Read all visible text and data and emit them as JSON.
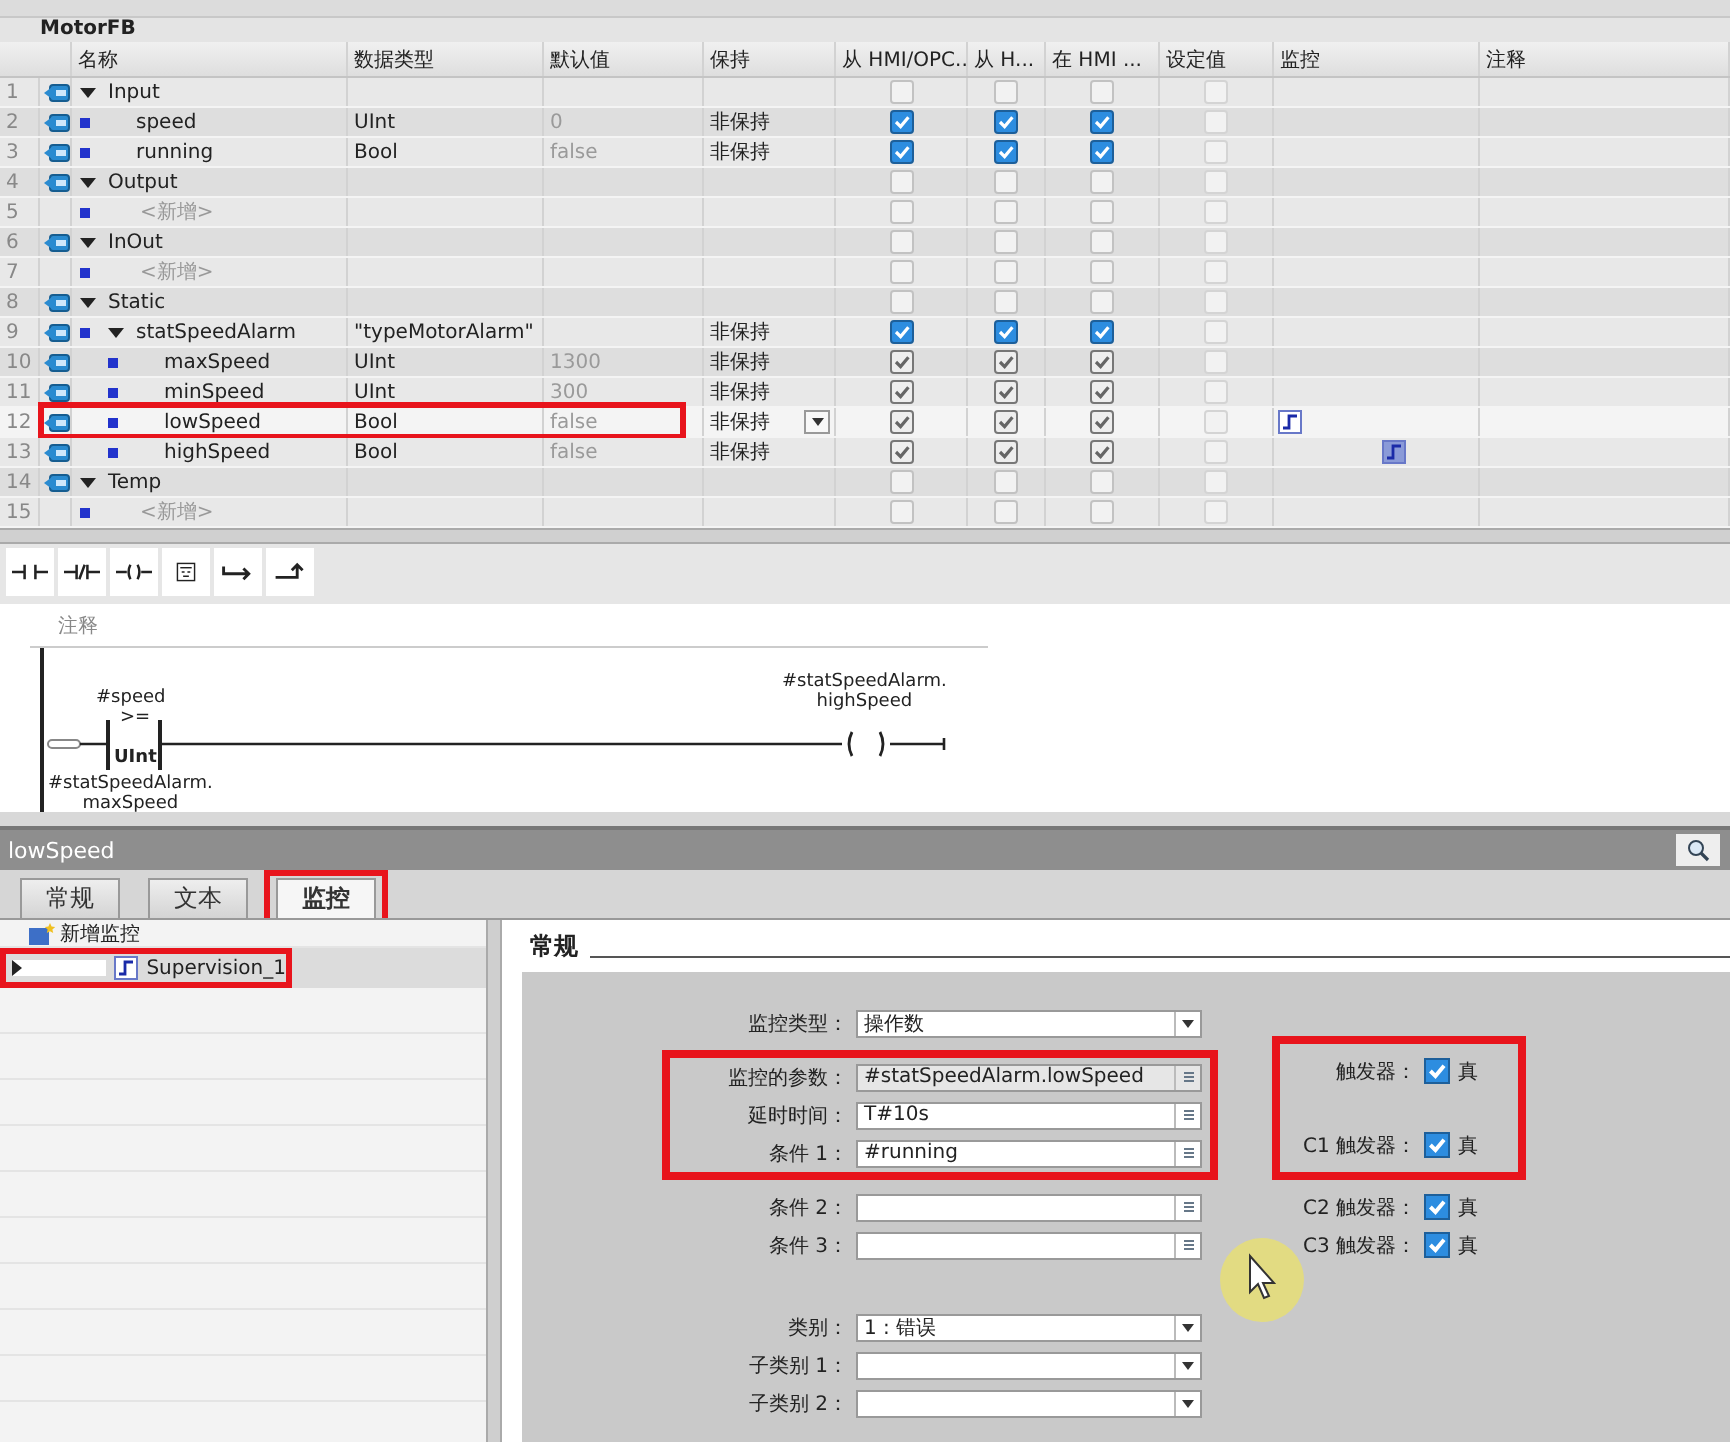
{
  "table": {
    "title": "MotorFB",
    "columns": [
      "名称",
      "数据类型",
      "默认值",
      "保持",
      "从 HMI/OPC..",
      "从 H...",
      "在 HMI ...",
      "设定值",
      "监控",
      "注释"
    ],
    "rows": [
      {
        "num": "1",
        "kind": "section",
        "name": "Input",
        "expanded": true,
        "hmi": [
          false,
          false,
          false
        ],
        "setpoint": false,
        "children": [
          {
            "num": "2",
            "kind": "member",
            "name": "speed",
            "type": "UInt",
            "default": "0",
            "retain": "非保持",
            "hmi": [
              true,
              true,
              true
            ],
            "setpoint": false
          },
          {
            "num": "3",
            "kind": "member",
            "name": "running",
            "type": "Bool",
            "default": "false",
            "retain": "非保持",
            "hmi": [
              true,
              true,
              true
            ],
            "setpoint": false
          }
        ]
      },
      {
        "num": "4",
        "kind": "section",
        "name": "Output",
        "expanded": true,
        "hmi": [
          false,
          false,
          false
        ],
        "setpoint": false,
        "children": [
          {
            "num": "5",
            "kind": "new",
            "name": "<新增>",
            "hmi": [
              false,
              false,
              false
            ],
            "setpoint": false
          }
        ]
      },
      {
        "num": "6",
        "kind": "section",
        "name": "InOut",
        "expanded": true,
        "hmi": [
          false,
          false,
          false
        ],
        "setpoint": false,
        "children": [
          {
            "num": "7",
            "kind": "new",
            "name": "<新增>",
            "hmi": [
              false,
              false,
              false
            ],
            "setpoint": false
          }
        ]
      },
      {
        "num": "8",
        "kind": "section",
        "name": "Static",
        "expanded": true,
        "hmi": [
          false,
          false,
          false
        ],
        "setpoint": false,
        "children": [
          {
            "num": "9",
            "kind": "member",
            "name": "statSpeedAlarm",
            "type": "\"typeMotorAlarm\"",
            "retain": "非保持",
            "expanded": true,
            "hmi": [
              true,
              true,
              true
            ],
            "setpoint": false,
            "children": [
              {
                "num": "10",
                "kind": "member",
                "name": "maxSpeed",
                "type": "UInt",
                "default": "1300",
                "retain": "非保持",
                "hmi": [
                  true,
                  true,
                  true
                ],
                "inherited": true,
                "setpoint": false
              },
              {
                "num": "11",
                "kind": "member",
                "name": "minSpeed",
                "type": "UInt",
                "default": "300",
                "retain": "非保持",
                "hmi": [
                  true,
                  true,
                  true
                ],
                "inherited": true,
                "setpoint": false
              },
              {
                "num": "12",
                "kind": "member",
                "name": "lowSpeed",
                "type": "Bool",
                "default": "false",
                "retain": "非保持",
                "hmi": [
                  true,
                  true,
                  true
                ],
                "inherited": true,
                "setpoint": false,
                "dropdown": true,
                "highlighted": true,
                "supervision": {
                  "selected": false
                }
              },
              {
                "num": "13",
                "kind": "member",
                "name": "highSpeed",
                "type": "Bool",
                "default": "false",
                "retain": "非保持",
                "hmi": [
                  true,
                  true,
                  true
                ],
                "inherited": true,
                "setpoint": false,
                "supervision": {
                  "selected": true
                }
              }
            ]
          }
        ]
      },
      {
        "num": "14",
        "kind": "section",
        "name": "Temp",
        "expanded": true,
        "hmi": [
          false,
          false,
          false
        ],
        "setpoint": false,
        "children": [
          {
            "num": "15",
            "kind": "new",
            "name": "<新增>",
            "hmi": [
              false,
              false,
              false
            ],
            "setpoint": false
          }
        ]
      }
    ]
  },
  "ladder": {
    "comment": "注释",
    "contact_operand": "#speed",
    "compare_op": ">=",
    "compare_type": "UInt",
    "compare_operand": [
      "#statSpeedAlarm.",
      "maxSpeed"
    ],
    "coil_operand": [
      "#statSpeedAlarm.",
      "highSpeed"
    ]
  },
  "properties": {
    "title": "lowSpeed",
    "tabs": [
      {
        "label": "常规",
        "selected": false,
        "highlighted": false
      },
      {
        "label": "文本",
        "selected": false,
        "highlighted": false
      },
      {
        "label": "监控",
        "selected": true,
        "highlighted": true
      }
    ],
    "supervisions": {
      "add_label": "新增监控",
      "items": [
        {
          "name": "Supervision_1",
          "selected": true,
          "highlighted": true
        }
      ]
    },
    "section_title": "常规",
    "field_groups": [
      {
        "highlighted": false,
        "fields": [
          {
            "label": "监控类型：",
            "value": "操作数",
            "kind": "dropdown"
          }
        ]
      },
      {
        "highlighted": true,
        "fields": [
          {
            "label": "监控的参数：",
            "value": "#statSpeedAlarm.lowSpeed",
            "kind": "readonly"
          },
          {
            "label": "延时时间：",
            "value": "T#10s",
            "kind": "input"
          },
          {
            "label": "条件 1：",
            "value": "#running",
            "kind": "input"
          }
        ]
      },
      {
        "highlighted": false,
        "fields": [
          {
            "label": "条件 2：",
            "kind": "input"
          },
          {
            "label": "条件 3：",
            "kind": "input"
          }
        ]
      },
      {
        "highlighted": false,
        "fields": [
          {
            "label": "类别：",
            "value": "1 : 错误",
            "kind": "dropdown"
          },
          {
            "label": "子类别 1：",
            "kind": "dropdown"
          },
          {
            "label": "子类别 2：",
            "kind": "dropdown"
          }
        ]
      }
    ],
    "trigger_groups": [
      {
        "highlighted": true,
        "triggers": [
          {
            "label": "触发器：",
            "text": "真",
            "checked": true
          },
          {
            "label": "C1 触发器：",
            "text": "真",
            "checked": true
          }
        ]
      },
      {
        "highlighted": false,
        "triggers": [
          {
            "label": "C2 触发器：",
            "text": "真",
            "checked": true
          },
          {
            "label": "C3 触发器：",
            "text": "真",
            "checked": true
          }
        ]
      }
    ]
  }
}
